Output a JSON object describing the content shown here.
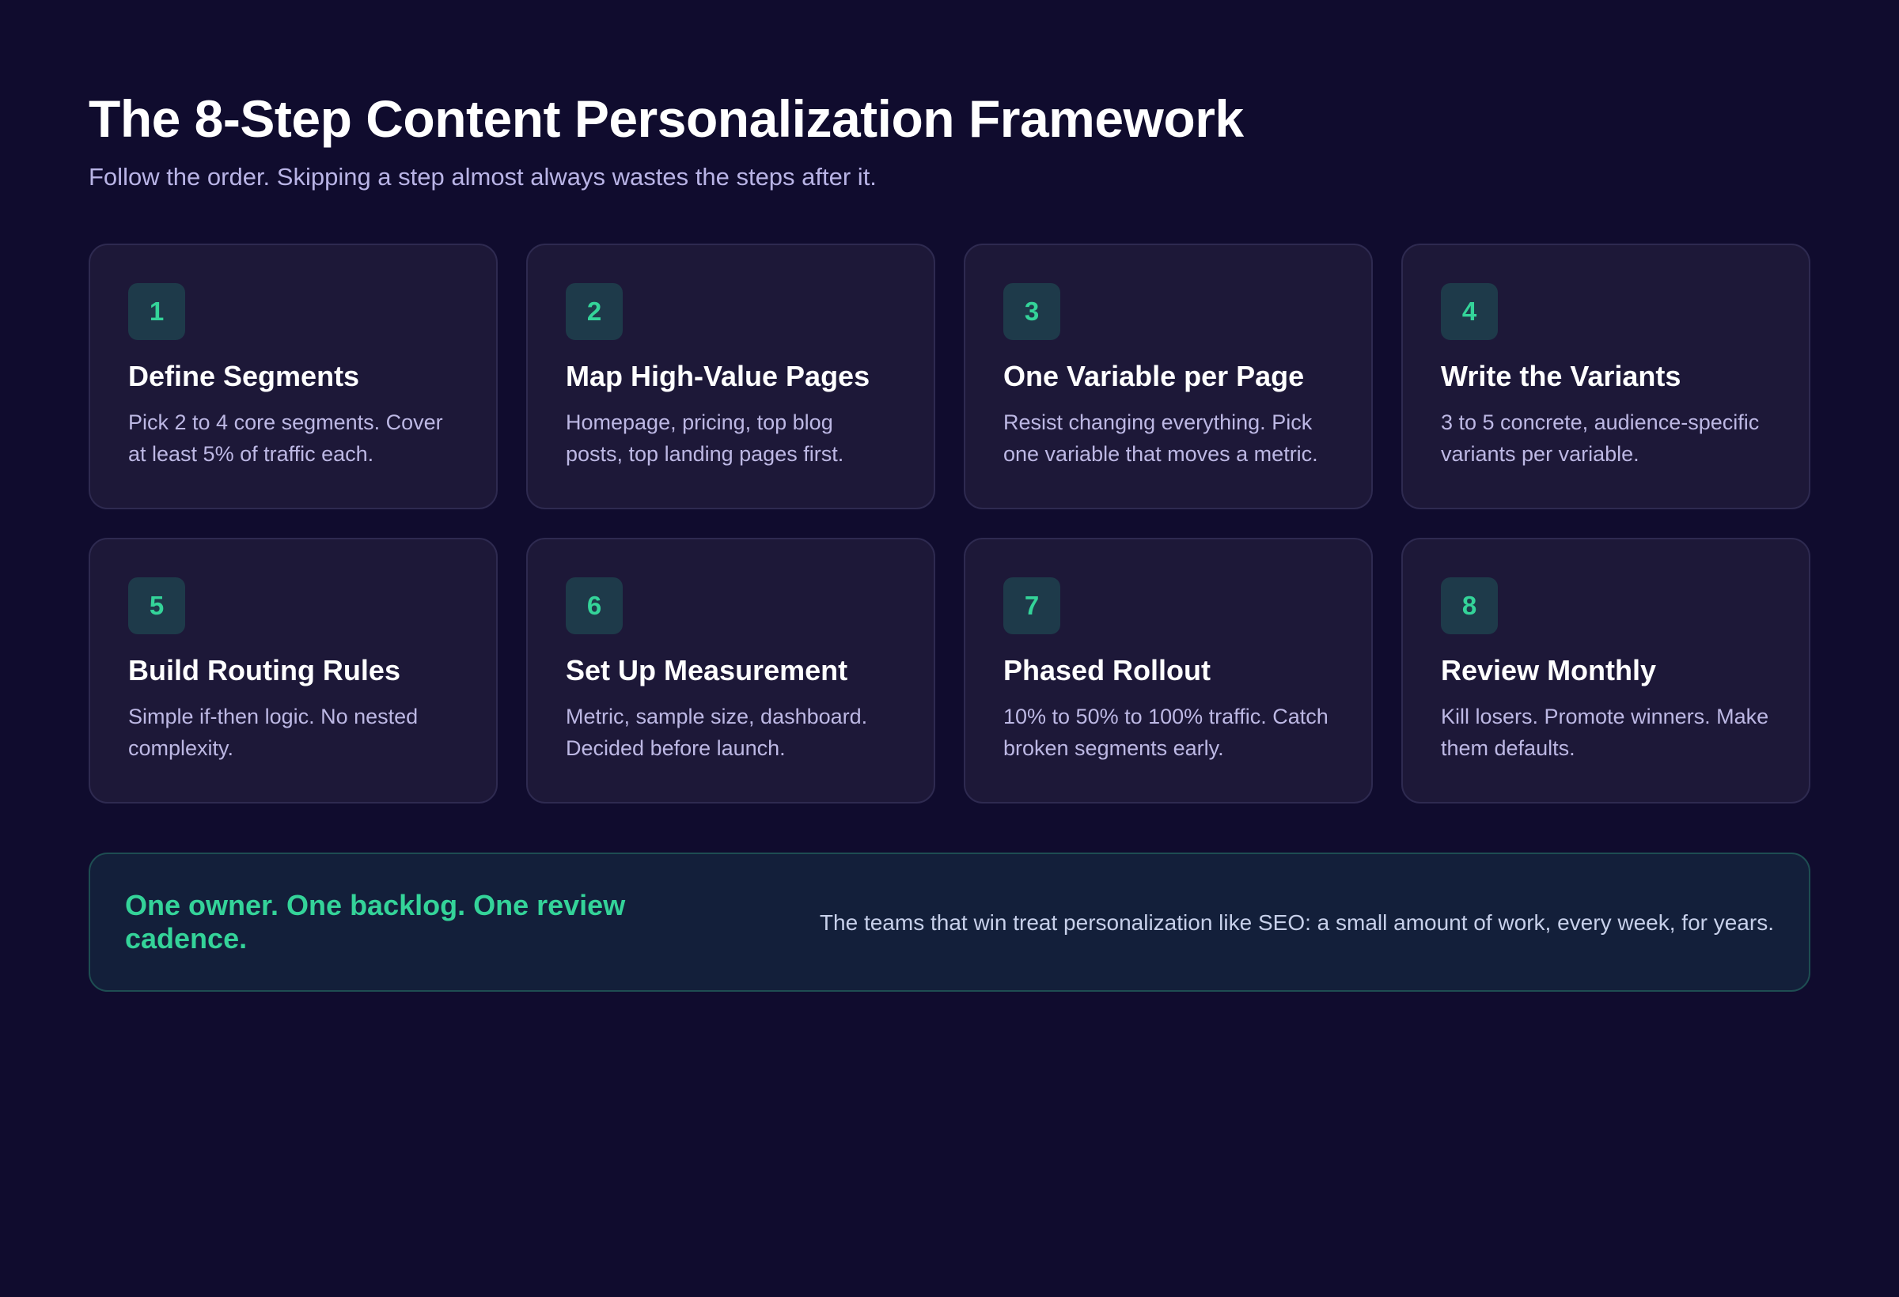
{
  "header": {
    "title": "The 8-Step Content Personalization Framework",
    "subtitle": "Follow the order. Skipping a step almost always wastes the steps after it."
  },
  "steps": [
    {
      "number": "1",
      "title": "Define Segments",
      "description": "Pick 2 to 4 core segments. Cover at least 5% of traffic each."
    },
    {
      "number": "2",
      "title": "Map High-Value Pages",
      "description": "Homepage, pricing, top blog posts, top landing pages first."
    },
    {
      "number": "3",
      "title": "One Variable per Page",
      "description": "Resist changing everything. Pick one variable that moves a metric."
    },
    {
      "number": "4",
      "title": "Write the Variants",
      "description": "3 to 5 concrete, audience-specific variants per variable."
    },
    {
      "number": "5",
      "title": "Build Routing Rules",
      "description": "Simple if-then logic. No nested complexity."
    },
    {
      "number": "6",
      "title": "Set Up Measurement",
      "description": "Metric, sample size, dashboard. Decided before launch."
    },
    {
      "number": "7",
      "title": "Phased Rollout",
      "description": "10% to 50% to 100% traffic. Catch broken segments early."
    },
    {
      "number": "8",
      "title": "Review Monthly",
      "description": "Kill losers. Promote winners. Make them defaults."
    }
  ],
  "banner": {
    "headline": "One owner. One backlog. One review cadence.",
    "text": "The teams that win treat personalization like SEO: a small amount of work, every week, for years."
  },
  "colors": {
    "background": "#100c2e",
    "card": "#1d1838",
    "accent": "#34d399",
    "badge": "#1e3a4a",
    "banner": "#131f3a"
  }
}
